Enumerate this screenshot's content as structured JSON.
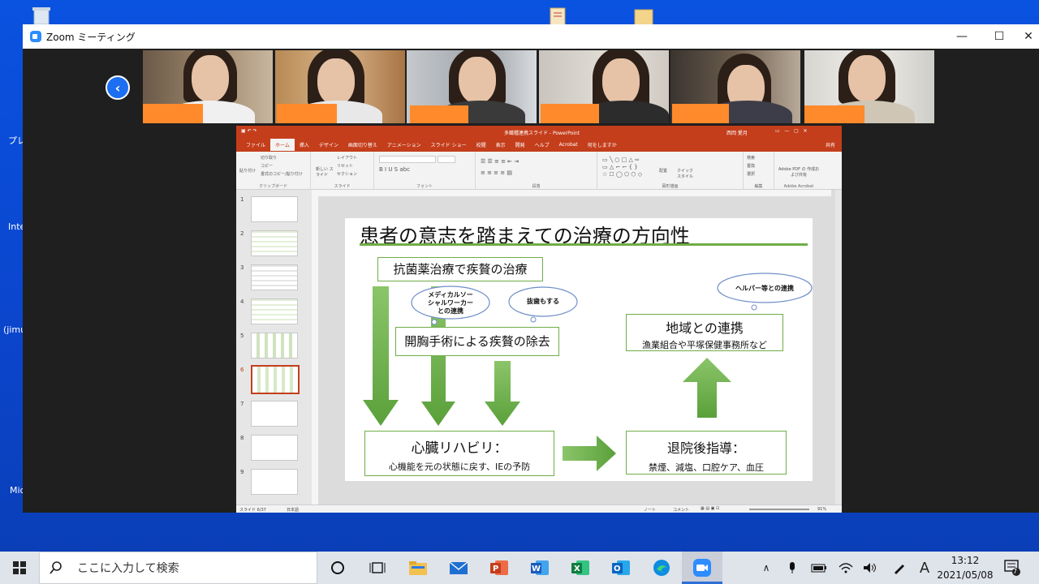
{
  "desktop": {
    "labels": [
      "プレ",
      "Inte",
      "(jimu",
      "Mic"
    ]
  },
  "zoom": {
    "title": "Zoom ミーティング",
    "min_icon": "—",
    "max_icon": "☐",
    "close_icon": "✕",
    "back_icon": "‹"
  },
  "ppt": {
    "title": "多職種連携スライド - PowerPoint",
    "user": "西岡 愛月",
    "tabs": [
      "ファイル",
      "ホーム",
      "挿入",
      "デザイン",
      "画面切り替え",
      "アニメーション",
      "スライド ショー",
      "校閲",
      "表示",
      "開発",
      "ヘルプ",
      "Acrobat",
      "何をしますか"
    ],
    "share": "共有",
    "ribbon": {
      "clipboard": "クリップボード",
      "slides": "スライド",
      "font": "フォント",
      "paragraph": "段落",
      "drawing": "図形描画",
      "editing": "編集",
      "acrobat": "Adobe Acrobat",
      "paste": "貼り付け",
      "cut": "切り取り",
      "copy": "コピー",
      "format_painter": "書式のコピー/貼り付け",
      "new_slide": "新しい スライド",
      "layout": "レイアウト",
      "reset": "リセット",
      "section": "セクション",
      "find": "検索",
      "replace": "置換",
      "select": "選択",
      "arrange": "配置",
      "quick_styles": "クイック スタイル",
      "acrobat_btn": "Adobe PDF の 作成および共有"
    },
    "thumb_numbers": [
      "1",
      "2",
      "3",
      "4",
      "5",
      "6",
      "7",
      "8",
      "9"
    ],
    "status": {
      "slide": "スライド 6/37",
      "lang": "日本語",
      "notes": "ノート",
      "comments": "コメント",
      "zoom": "91%"
    }
  },
  "slide": {
    "title": "患者の意志を踏まえての治療の方向性",
    "box_antibiotic": "抗菌薬治療で疾贅の治療",
    "box_surgery": "開胸手術による疾贅の除去",
    "box_rehab_title": "心臓リハビリ：",
    "box_rehab_sub": "心機能を元の状態に戻す、IEの予防",
    "box_discharge_title": "退院後指導：",
    "box_discharge_sub": "禁煙、減塩、口腔ケア、血圧",
    "box_community_title": "地域との連携",
    "box_community_sub": "漁業組合や平塚保健事務所など",
    "cloud_msw": "メディカルソー\nシャルワーカー\nとの連携",
    "cloud_tooth": "抜歯もする",
    "cloud_helper": "ヘルパー等との連携"
  },
  "taskbar": {
    "search_placeholder": "ここに入力して検索",
    "ime": "A",
    "time": "13:12",
    "date": "2021/05/08",
    "notif_count": "7"
  },
  "colors": {
    "ppt_accent": "#c43e1c",
    "green": "#70ad47",
    "nameplate": "#ff8a2b",
    "zoom_blue": "#2d8cff"
  }
}
